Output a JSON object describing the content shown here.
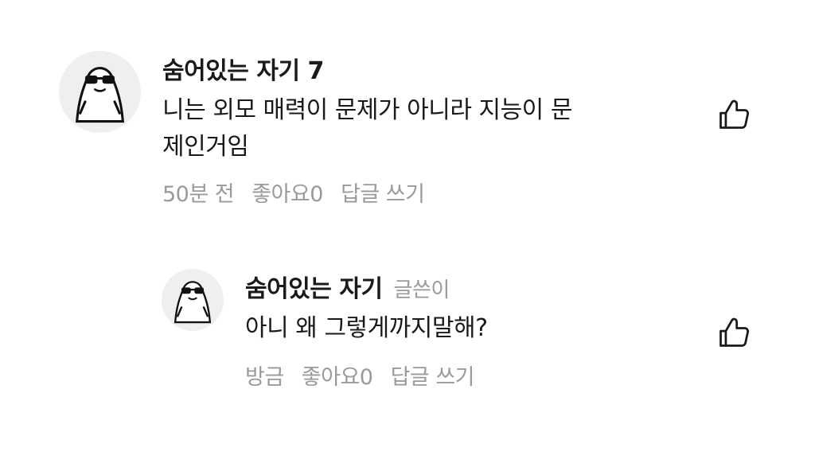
{
  "comments": [
    {
      "author": "숨어있는 자기 7",
      "text_line1": "니는 외모 매력이 문제가 아니라 지능이 문",
      "text_line2": "제인거임",
      "time": "50분 전",
      "like_label": "좋아요0",
      "reply_label": "답글 쓰기"
    },
    {
      "author": "숨어있는 자기",
      "badge": "글쓴이",
      "text_line1": "아니 왜 그렇게까지말해?",
      "time": "방금",
      "like_label": "좋아요0",
      "reply_label": "답글 쓰기"
    }
  ],
  "icons": {
    "avatar": "penguin-with-sunglasses-icon",
    "like": "thumbs-up-icon"
  },
  "colors": {
    "text": "#1a1a1a",
    "muted": "#9a9a9a",
    "avatar_bg": "#efefef"
  }
}
